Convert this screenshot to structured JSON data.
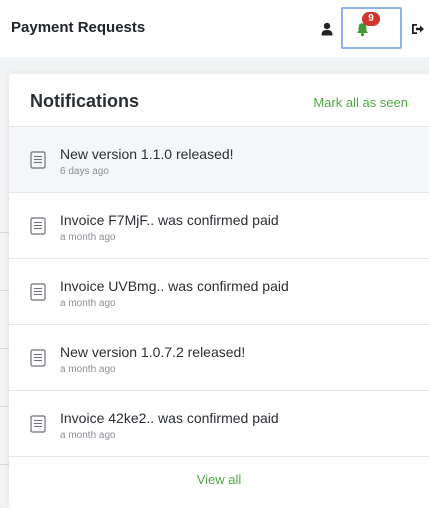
{
  "header": {
    "title": "Payment Requests",
    "notification_count": "9",
    "accent_color": "#51a846",
    "badge_color": "#d1362c",
    "icons": [
      "user-icon",
      "bell-icon",
      "logout-icon"
    ]
  },
  "notifications_panel": {
    "title": "Notifications",
    "mark_all_label": "Mark all as seen",
    "view_all_label": "View all",
    "items": [
      {
        "text": "New version 1.1.0 released!",
        "time": "6 days ago",
        "icon": "document-icon"
      },
      {
        "text": "Invoice F7MjF.. was confirmed paid",
        "time": "a month ago",
        "icon": "document-icon"
      },
      {
        "text": "Invoice UVBmg.. was confirmed paid",
        "time": "a month ago",
        "icon": "document-icon"
      },
      {
        "text": "New version 1.0.7.2 released!",
        "time": "a month ago",
        "icon": "document-icon"
      },
      {
        "text": "Invoice 42ke2.. was confirmed paid",
        "time": "a month ago",
        "icon": "document-icon"
      }
    ]
  }
}
